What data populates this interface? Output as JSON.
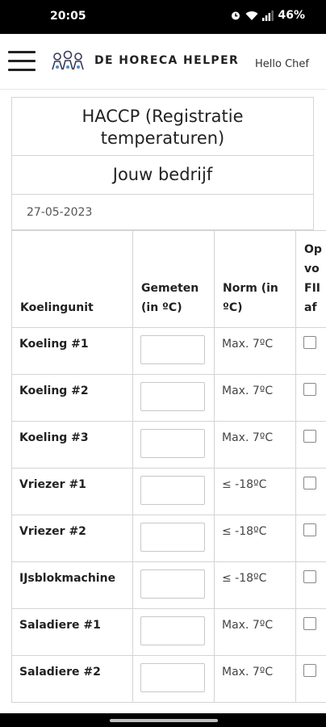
{
  "status_bar": {
    "time": "20:05",
    "battery": "46%"
  },
  "header": {
    "brand": "DE HORECA HELPER",
    "greeting": "Hello Chef"
  },
  "form": {
    "title_line1": "HACCP (Registratie",
    "title_line2": "temperaturen)",
    "company": "Jouw bedrijf",
    "date": "27-05-2023"
  },
  "table": {
    "headers": {
      "unit": "Koelingunit",
      "measured_line1": "Gemeten",
      "measured_line2": "(in ºC)",
      "norm_line1": "Norm (in",
      "norm_line2": "ºC)",
      "extra_line1": "Op",
      "extra_line2": "vo",
      "extra_line3": "FII",
      "extra_line4": "af"
    },
    "rows": [
      {
        "unit": "Koeling #1",
        "norm": "Max. 7ºC",
        "value": ""
      },
      {
        "unit": "Koeling #2",
        "norm": "Max. 7ºC",
        "value": ""
      },
      {
        "unit": "Koeling #3",
        "norm": "Max. 7ºC",
        "value": ""
      },
      {
        "unit": "Vriezer #1",
        "norm": "≤ -18ºC",
        "value": ""
      },
      {
        "unit": "Vriezer #2",
        "norm": "≤ -18ºC",
        "value": ""
      },
      {
        "unit": "IJsblokmachine",
        "norm": "≤ -18ºC",
        "value": ""
      },
      {
        "unit": "Saladiere #1",
        "norm": "Max. 7ºC",
        "value": ""
      },
      {
        "unit": "Saladiere #2",
        "norm": "Max. 7ºC",
        "value": ""
      }
    ]
  },
  "icons": {
    "menu": "hamburger-menu-icon",
    "logo": "chefs-logo-icon",
    "alarm": "alarm-icon",
    "wifi": "wifi-icon",
    "signal": "signal-icon"
  },
  "colors": {
    "status_bar": "#000000",
    "border": "#d4d4d4",
    "background": "#ffffff"
  }
}
